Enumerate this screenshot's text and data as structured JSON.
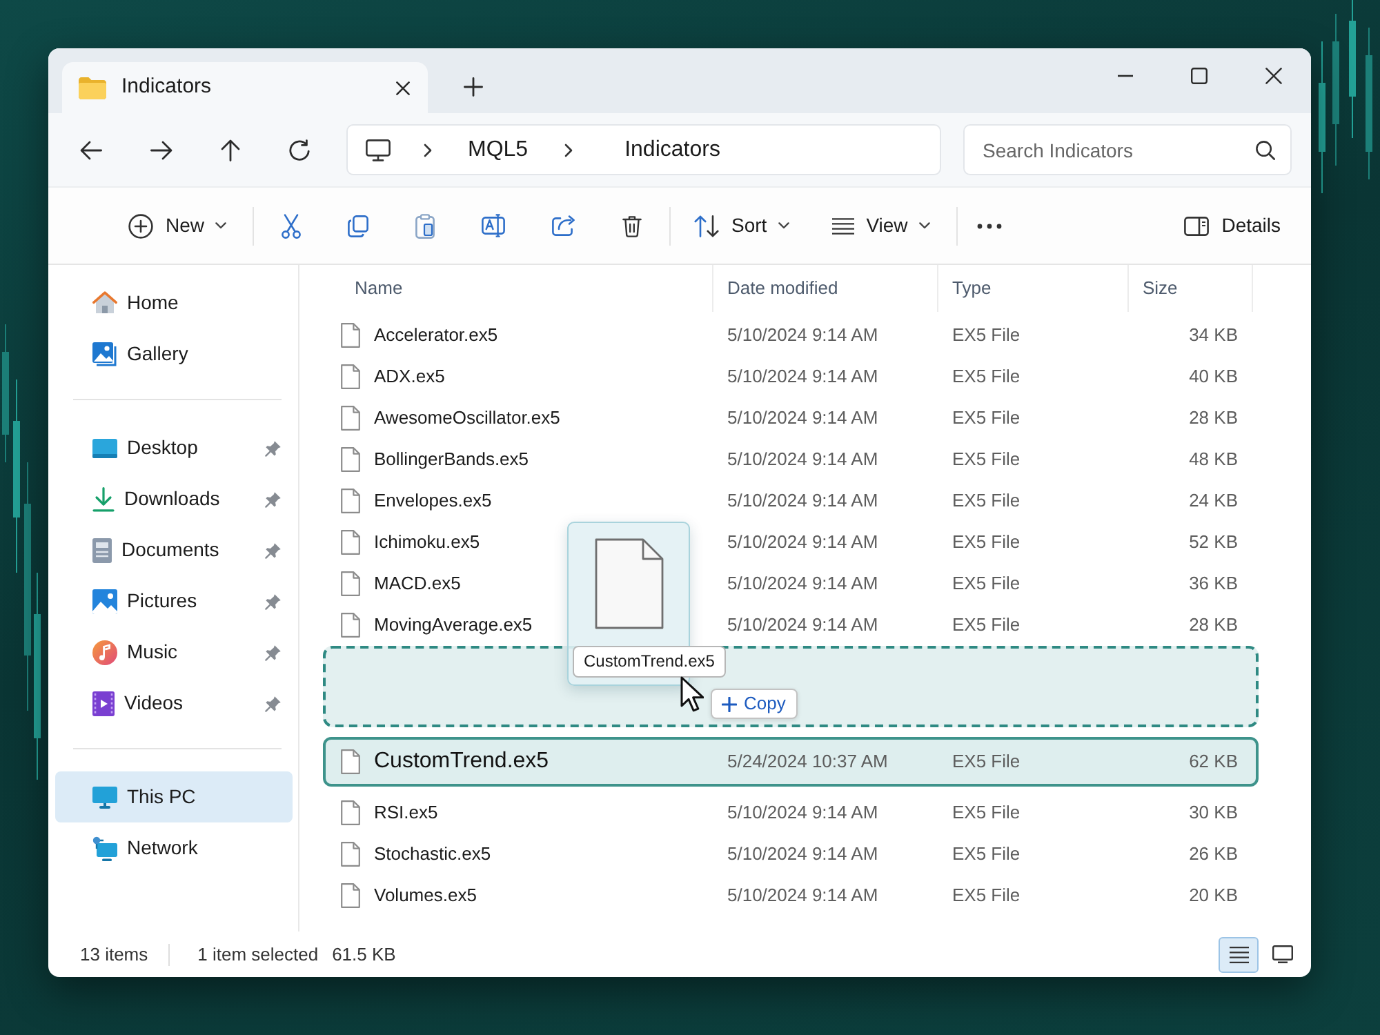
{
  "tabs": [
    {
      "title": "Indicators",
      "selected": true
    }
  ],
  "address_bar": {
    "path": [
      "MQL5",
      "Indicators"
    ]
  },
  "search": {
    "placeholder": "Search Indicators"
  },
  "toolbar": {
    "new": "New",
    "sort": "Sort",
    "view": "View",
    "details": "Details"
  },
  "sidebar": {
    "sections": [
      {
        "items": [
          {
            "label": "Home",
            "pinned": false,
            "selected": false
          },
          {
            "label": "Gallery",
            "pinned": false,
            "selected": false
          }
        ]
      },
      {
        "items": [
          {
            "label": "Desktop",
            "pinned": true,
            "selected": false
          },
          {
            "label": "Downloads",
            "pinned": true,
            "selected": false
          },
          {
            "label": "Documents",
            "pinned": true,
            "selected": false
          },
          {
            "label": "Pictures",
            "pinned": true,
            "selected": false
          },
          {
            "label": "Music",
            "pinned": true,
            "selected": false
          },
          {
            "label": "Videos",
            "pinned": true,
            "selected": false
          }
        ]
      },
      {
        "items": [
          {
            "label": "This PC",
            "pinned": false,
            "selected": true
          },
          {
            "label": "Network",
            "pinned": false,
            "selected": false
          }
        ]
      }
    ]
  },
  "file_list": {
    "columns": [
      "Name",
      "Date modified",
      "Type",
      "Size"
    ],
    "rows": [
      {
        "kind": "file",
        "name": "Accelerator.ex5",
        "date_modified": "5/10/2024 9:14 AM",
        "type": "EX5 File",
        "size": "34 KB",
        "selected": false
      },
      {
        "kind": "file",
        "name": "ADX.ex5",
        "date_modified": "5/10/2024 9:14 AM",
        "type": "EX5 File",
        "size": "40 KB",
        "selected": false
      },
      {
        "kind": "file",
        "name": "AwesomeOscillator.ex5",
        "date_modified": "5/10/2024 9:14 AM",
        "type": "EX5 File",
        "size": "28 KB",
        "selected": false
      },
      {
        "kind": "file",
        "name": "BollingerBands.ex5",
        "date_modified": "5/10/2024 9:14 AM",
        "type": "EX5 File",
        "size": "48 KB",
        "selected": false
      },
      {
        "kind": "file",
        "name": "Envelopes.ex5",
        "date_modified": "5/10/2024 9:14 AM",
        "type": "EX5 File",
        "size": "24 KB",
        "selected": false
      },
      {
        "kind": "file",
        "name": "Ichimoku.ex5",
        "date_modified": "5/10/2024 9:14 AM",
        "type": "EX5 File",
        "size": "52 KB",
        "selected": false
      },
      {
        "kind": "file",
        "name": "MACD.ex5",
        "date_modified": "5/10/2024 9:14 AM",
        "type": "EX5 File",
        "size": "36 KB",
        "selected": false
      },
      {
        "kind": "file",
        "name": "MovingAverage.ex5",
        "date_modified": "5/10/2024 9:14 AM",
        "type": "EX5 File",
        "size": "28 KB",
        "selected": false
      },
      {
        "kind": "drop_zone"
      },
      {
        "kind": "file",
        "name": "CustomTrend.ex5",
        "date_modified": "5/24/2024 10:37 AM",
        "type": "EX5 File",
        "size": "62 KB",
        "selected": true
      },
      {
        "kind": "file",
        "name": "RSI.ex5",
        "date_modified": "5/10/2024 9:14 AM",
        "type": "EX5 File",
        "size": "30 KB",
        "selected": false
      },
      {
        "kind": "file",
        "name": "Stochastic.ex5",
        "date_modified": "5/10/2024 9:14 AM",
        "type": "EX5 File",
        "size": "26 KB",
        "selected": false
      },
      {
        "kind": "file",
        "name": "Volumes.ex5",
        "date_modified": "5/10/2024 9:14 AM",
        "type": "EX5 File",
        "size": "20 KB",
        "selected": false
      }
    ]
  },
  "drag_preview": {
    "label": "CustomTrend.ex5",
    "effect": "Copy"
  },
  "status_bar": {
    "item_count": "13 items",
    "selection": "1 item selected",
    "selection_size": "61.5 KB",
    "view_modes": [
      {
        "selected": true
      },
      {
        "selected": false
      }
    ]
  }
}
